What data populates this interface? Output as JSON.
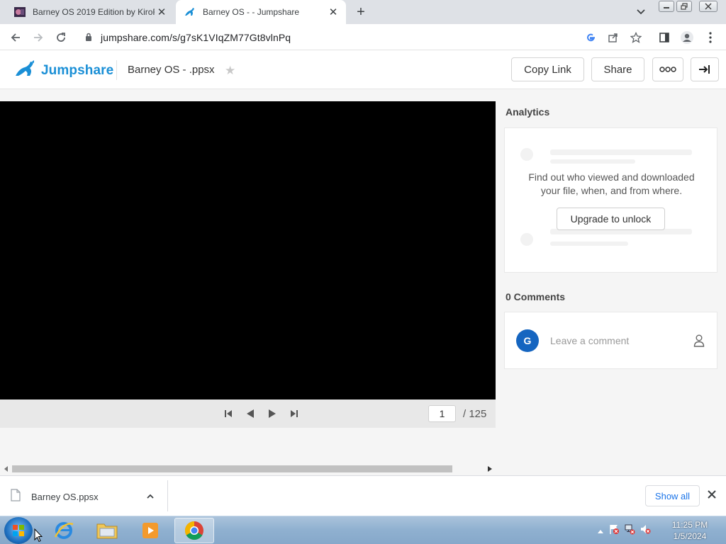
{
  "browser": {
    "tabs": [
      {
        "title": "Barney OS 2019 Edition by KiroR",
        "active": false,
        "favicon": "image-thumbnail-icon"
      },
      {
        "title": "Barney OS - - Jumpshare",
        "active": true,
        "favicon": "kangaroo-icon"
      }
    ],
    "url": "jumpshare.com/s/g7sK1VIqZM77Gt8vlnPq"
  },
  "jumpshare": {
    "brand": "Jumpshare",
    "brand_color": "#1a8fd6",
    "file_title": "Barney OS - .ppsx",
    "buttons": {
      "copy_link": "Copy Link",
      "share": "Share"
    }
  },
  "viewer": {
    "current_page": "1",
    "total_pages": "/ 125"
  },
  "analytics": {
    "title": "Analytics",
    "message_line1": "Find out who viewed and downloaded",
    "message_line2": "your file, when, and from where.",
    "upgrade_label": "Upgrade to unlock"
  },
  "comments": {
    "title": "0 Comments",
    "avatar_initial": "G",
    "placeholder": "Leave a comment"
  },
  "downloads": {
    "file_name": "Barney OS.ppsx",
    "show_all": "Show all"
  },
  "taskbar": {
    "time": "11:25 PM",
    "date": "1/5/2024"
  }
}
